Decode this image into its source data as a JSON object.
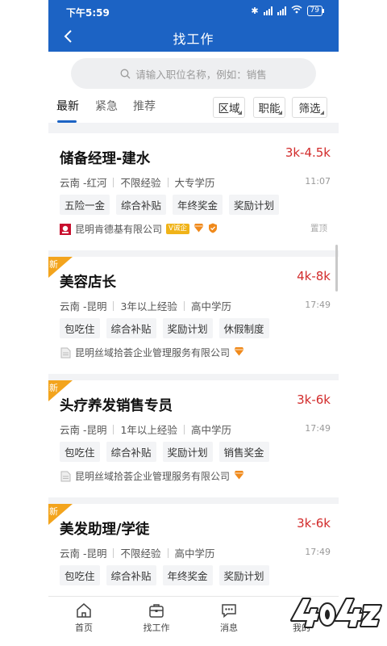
{
  "status_bar": {
    "time": "下午5:59",
    "battery": "79"
  },
  "header": {
    "title": "找工作"
  },
  "search": {
    "placeholder": "请输入职位名称，例如：销售"
  },
  "tabs": [
    {
      "label": "最新",
      "active": true
    },
    {
      "label": "紧急",
      "active": false
    },
    {
      "label": "推荐",
      "active": false
    }
  ],
  "filters": [
    "区域",
    "职能",
    "筛选"
  ],
  "jobs": [
    {
      "title": "储备经理-建水",
      "salary": "3k-4.5k",
      "location": "云南 -红河",
      "experience": "不限经验",
      "education": "大专学历",
      "time": "11:07",
      "tags": [
        "五险一金",
        "综合补贴",
        "年终奖金",
        "奖励计划"
      ],
      "company": "昆明肯德基有限公司",
      "badge": "V诚企",
      "is_new": false,
      "pinned": "置顶"
    },
    {
      "title": "美容店长",
      "salary": "4k-8k",
      "location": "云南 -昆明",
      "experience": "3年以上经验",
      "education": "高中学历",
      "time": "17:49",
      "tags": [
        "包吃住",
        "综合补贴",
        "奖励计划",
        "休假制度"
      ],
      "company": "昆明丝域拾荟企业管理服务有限公司",
      "is_new": true,
      "new_label": "新"
    },
    {
      "title": "头疗养发销售专员",
      "salary": "3k-6k",
      "location": "云南 -昆明",
      "experience": "1年以上经验",
      "education": "高中学历",
      "time": "17:49",
      "tags": [
        "包吃住",
        "综合补贴",
        "奖励计划",
        "销售奖金"
      ],
      "company": "昆明丝域拾荟企业管理服务有限公司",
      "is_new": true,
      "new_label": "新"
    },
    {
      "title": "美发助理/学徒",
      "salary": "3k-6k",
      "location": "云南 -昆明",
      "experience": "不限经验",
      "education": "高中学历",
      "time": "17:49",
      "tags": [
        "包吃住",
        "综合补贴",
        "年终奖金",
        "奖励计划"
      ],
      "is_new": true,
      "new_label": "新"
    }
  ],
  "tabbar": [
    {
      "label": "首页",
      "icon": "home-icon"
    },
    {
      "label": "找工作",
      "icon": "briefcase-icon"
    },
    {
      "label": "消息",
      "icon": "message-icon"
    },
    {
      "label": "我的",
      "icon": "user-icon"
    }
  ],
  "watermark": "4040Z",
  "colors": {
    "primary": "#1c63c4",
    "salary": "#d22b2b",
    "new_tag": "#f3a41d",
    "diamond": "#f08a1c"
  }
}
